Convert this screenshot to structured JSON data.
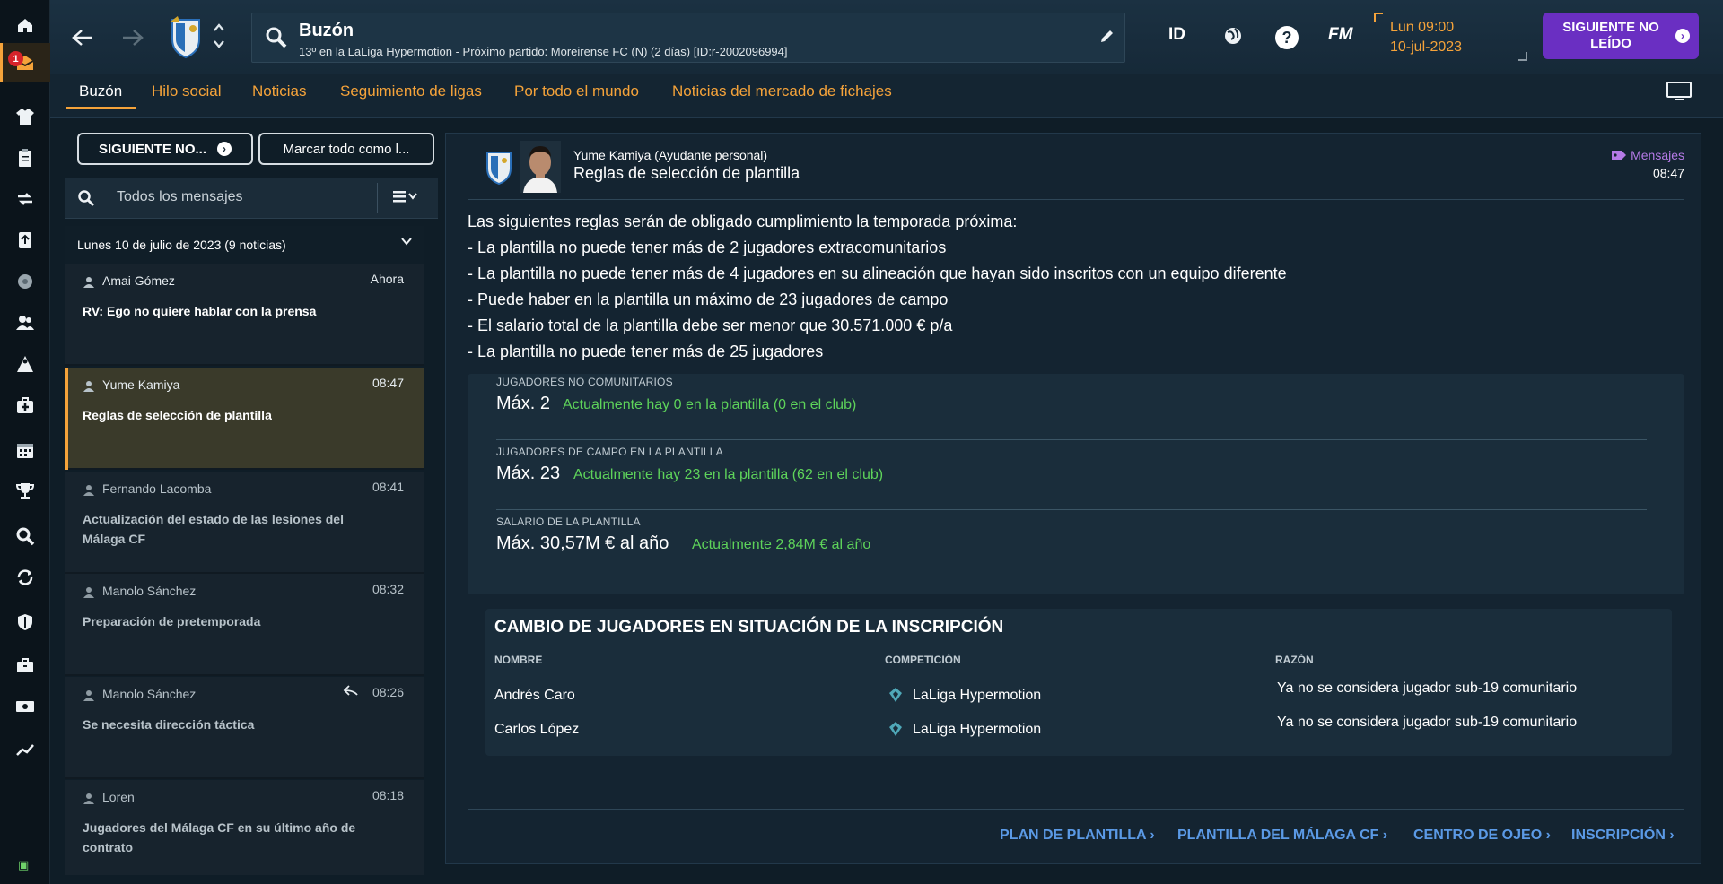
{
  "rail": {
    "badge": "1",
    "items": [
      "home-icon",
      "inbox-icon",
      "shirt-icon",
      "clipboard-icon",
      "transfer-icon",
      "upload-icon",
      "ball-icon",
      "people-icon",
      "coach-icon",
      "medical-icon",
      "calendar-icon",
      "trophy-icon",
      "search-icon",
      "refresh-icon",
      "shield-icon",
      "briefcase-icon",
      "money-icon",
      "chart-icon"
    ]
  },
  "header": {
    "title": "Buzón",
    "subtitle": "13º en la LaLiga Hypermotion - Próximo partido: Moreirense FC (N) (2 días) [ID:r-2002096994]",
    "id_label": "ID",
    "fm_label": "FM",
    "help_label": "?",
    "date_line1": "Lun 09:00",
    "date_line2": "10-jul-2023",
    "next_unread": "SIGUIENTE NO LEÍDO"
  },
  "tabs": [
    {
      "label": "Buzón",
      "active": true
    },
    {
      "label": "Hilo social"
    },
    {
      "label": "Noticias"
    },
    {
      "label": "Seguimiento de ligas"
    },
    {
      "label": "Por todo el mundo"
    },
    {
      "label": "Noticias del mercado de fichajes"
    }
  ],
  "inbox": {
    "next_btn": "SIGUIENTE NO...",
    "mark_all_btn": "Marcar todo como l...",
    "filter_placeholder": "Todos los mensajes",
    "date_group": "Lunes 10 de julio de 2023 (9 noticias)",
    "messages": [
      {
        "from": "Amai Gómez",
        "time": "Ahora",
        "subject": "RV: Ego no quiere hablar con la prensa",
        "state": "unread"
      },
      {
        "from": "Yume Kamiya",
        "time": "08:47",
        "subject": "Reglas de selección de plantilla",
        "state": "active"
      },
      {
        "from": "Fernando Lacomba",
        "time": "08:41",
        "subject": "Actualización del estado de las lesiones del Málaga CF",
        "state": "read"
      },
      {
        "from": "Manolo Sánchez",
        "time": "08:32",
        "subject": "Preparación de pretemporada",
        "state": "read"
      },
      {
        "from": "Manolo Sánchez",
        "time": "08:26",
        "subject": "Se necesita dirección táctica",
        "state": "read",
        "replied": true
      },
      {
        "from": "Loren",
        "time": "08:18",
        "subject": "Jugadores del Málaga CF en su último año de contrato",
        "state": "read"
      }
    ]
  },
  "message": {
    "from": "Yume Kamiya  (Ayudante personal)",
    "subject": "Reglas de selección de plantilla",
    "tag": "Mensajes",
    "time": "08:47",
    "body": [
      "Las siguientes reglas serán de obligado cumplimiento la temporada próxima:",
      "- La plantilla no puede tener más de 2 jugadores extracomunitarios",
      "- La plantilla no puede tener más de 4 jugadores en su alineación que hayan sido inscritos con un equipo diferente",
      "- Puede haber en la plantilla un máximo de 23 jugadores de campo",
      "- El salario total de la plantilla debe ser menor que 30.571.000 € p/a",
      "- La plantilla no puede tener más de 25 jugadores"
    ],
    "rules": [
      {
        "label": "JUGADORES NO COMUNITARIOS",
        "max": "Máx. 2",
        "current": "Actualmente hay 0 en la plantilla (0 en el club)"
      },
      {
        "label": "JUGADORES DE CAMPO EN LA PLANTILLA",
        "max": "Máx. 23",
        "current": "Actualmente hay 23 en la plantilla (62 en el club)"
      },
      {
        "label": "SALARIO DE LA PLANTILLA",
        "max": "Máx. 30,57M € al año",
        "current": "Actualmente 2,84M € al año"
      }
    ],
    "changes": {
      "title": "CAMBIO DE JUGADORES EN SITUACIÓN DE LA INSCRIPCIÓN",
      "col_name": "NOMBRE",
      "col_comp": "COMPETICIÓN",
      "col_reason": "RAZÓN",
      "rows": [
        {
          "name": "Andrés Caro",
          "comp": "LaLiga Hypermotion",
          "reason": "Ya no se considera jugador sub-19 comunitario"
        },
        {
          "name": "Carlos López",
          "comp": "LaLiga Hypermotion",
          "reason": "Ya no se considera jugador sub-19 comunitario"
        }
      ]
    },
    "links": [
      "PLAN DE PLANTILLA",
      "PLANTILLA DEL MÁLAGA CF",
      "CENTRO DE OJEO",
      "INSCRIPCIÓN"
    ]
  },
  "colors": {
    "accent": "#f5a33a",
    "purple": "#6a2fc2",
    "green": "#5ed35a",
    "link": "#5b9ae6",
    "tag": "#b57ae6"
  }
}
